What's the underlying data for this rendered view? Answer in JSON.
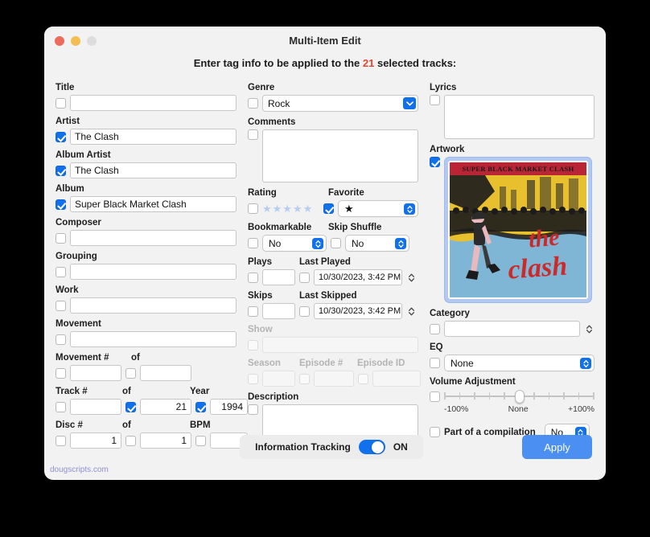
{
  "window": {
    "title": "Multi-Item Edit",
    "subtitle_before": "Enter tag info to be applied to the ",
    "subtitle_count": "21",
    "subtitle_after": " selected tracks:",
    "footer_link": "dougscripts.com"
  },
  "colors": {
    "accent": "#1170ec",
    "apply_button": "#4b8ff2",
    "count_red": "#e8442c",
    "link_purple": "#8f8fd4",
    "artwork_band": "#b92535",
    "artwork_sky": "#7fb6d6",
    "artwork_yellow": "#e8c02e"
  },
  "left_column": {
    "title": {
      "label": "Title",
      "value": "",
      "checked": false
    },
    "artist": {
      "label": "Artist",
      "value": "The Clash",
      "checked": true
    },
    "album_artist": {
      "label": "Album Artist",
      "value": "The Clash",
      "checked": true
    },
    "album": {
      "label": "Album",
      "value": "Super Black Market Clash",
      "checked": true
    },
    "composer": {
      "label": "Composer",
      "value": "",
      "checked": false
    },
    "grouping": {
      "label": "Grouping",
      "value": "",
      "checked": false
    },
    "work": {
      "label": "Work",
      "value": "",
      "checked": false
    },
    "movement": {
      "label": "Movement",
      "value": "",
      "checked": false
    },
    "movement_num": {
      "label": "Movement #",
      "value": "",
      "checked": false
    },
    "movement_of": {
      "label": "of",
      "value": "",
      "checked": false
    },
    "track_num": {
      "label": "Track #",
      "value": "",
      "checked": false
    },
    "track_of": {
      "label": "of",
      "value": "21",
      "checked": true
    },
    "year": {
      "label": "Year",
      "value": "1994",
      "checked": true
    },
    "disc_num": {
      "label": "Disc #",
      "value": "1",
      "checked": false
    },
    "disc_of": {
      "label": "of",
      "value": "1",
      "checked": false
    },
    "bpm": {
      "label": "BPM",
      "value": "",
      "checked": false
    }
  },
  "middle_column": {
    "genre": {
      "label": "Genre",
      "value": "Rock",
      "checked": false
    },
    "comments": {
      "label": "Comments",
      "value": "",
      "checked": false
    },
    "rating": {
      "label": "Rating",
      "stars": "★★★★★",
      "filled": 0,
      "checked": false
    },
    "favorite": {
      "label": "Favorite",
      "value": "★",
      "checked": true
    },
    "bookmarkable": {
      "label": "Bookmarkable",
      "value": "No",
      "checked": false
    },
    "skip_shuffle": {
      "label": "Skip Shuffle",
      "value": "No",
      "checked": false
    },
    "plays": {
      "label": "Plays",
      "value": "",
      "checked": false
    },
    "last_played": {
      "label": "Last Played",
      "value": "10/30/2023,   3:42 PM",
      "checked": false
    },
    "skips": {
      "label": "Skips",
      "value": "",
      "checked": false
    },
    "last_skipped": {
      "label": "Last Skipped",
      "value": "10/30/2023,   3:42 PM",
      "checked": false
    },
    "show": {
      "label": "Show",
      "value": "",
      "checked": false,
      "disabled": true
    },
    "season": {
      "label": "Season",
      "value": "",
      "checked": false,
      "disabled": true
    },
    "episode_num": {
      "label": "Episode #",
      "value": "",
      "checked": false,
      "disabled": true
    },
    "episode_id": {
      "label": "Episode ID",
      "value": "",
      "checked": false,
      "disabled": true
    },
    "description": {
      "label": "Description",
      "value": "",
      "checked": false
    }
  },
  "right_column": {
    "lyrics": {
      "label": "Lyrics",
      "value": "",
      "checked": false
    },
    "artwork": {
      "label": "Artwork",
      "checked": true,
      "album_title": "SUPER BLACK MARKET CLASH",
      "band_text": "the clash"
    },
    "category": {
      "label": "Category",
      "value": "",
      "checked": false
    },
    "eq": {
      "label": "EQ",
      "value": "None",
      "checked": false
    },
    "volume": {
      "label": "Volume Adjustment",
      "min_label": "-100%",
      "mid_label": "None",
      "max_label": "+100%",
      "value": 0,
      "checked": false
    },
    "compilation": {
      "label": "Part of a compilation",
      "value": "No",
      "checked": false
    }
  },
  "footer": {
    "tracking_label": "Information Tracking",
    "tracking_state": "ON",
    "tracking_on": true,
    "apply_label": "Apply"
  }
}
